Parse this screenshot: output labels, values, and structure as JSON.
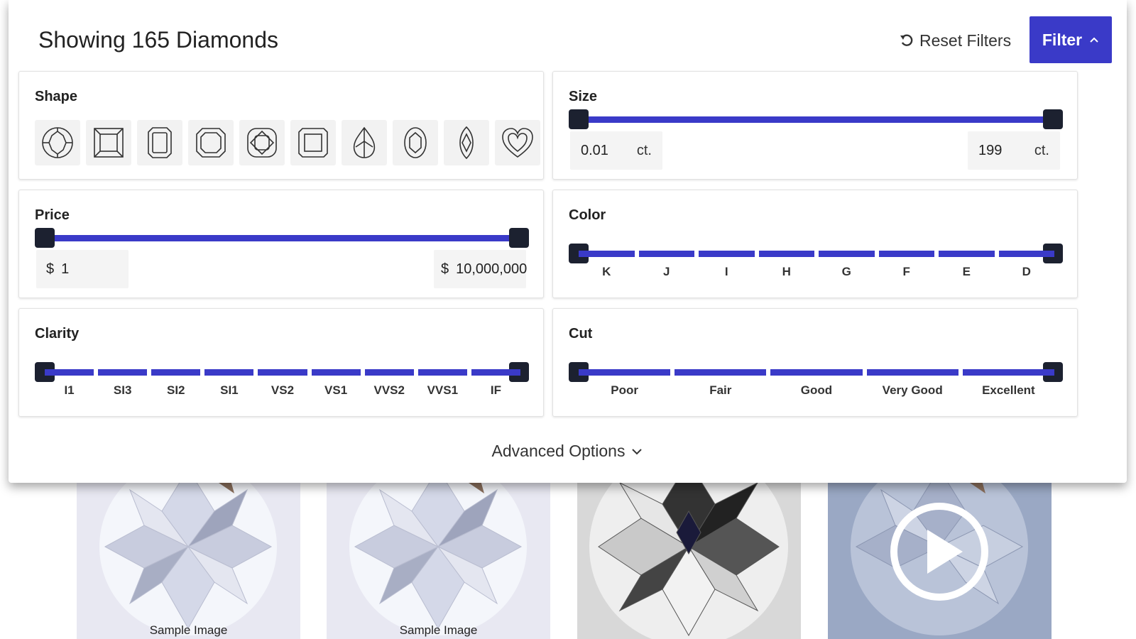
{
  "header": {
    "title": "Showing 165 Diamonds",
    "reset_label": "Reset Filters",
    "filter_label": "Filter"
  },
  "shape": {
    "title": "Shape",
    "icons": [
      "round-shape-icon",
      "princess-shape-icon",
      "emerald-shape-icon",
      "asscher-shape-icon",
      "cushion-shape-icon",
      "radiant-shape-icon",
      "pear-shape-icon",
      "oval-shape-icon",
      "marquise-shape-icon",
      "heart-shape-icon"
    ]
  },
  "size": {
    "title": "Size",
    "min": "0.01",
    "max": "199",
    "unit": "ct."
  },
  "price": {
    "title": "Price",
    "currency": "$",
    "min": "1",
    "max": "10,000,000"
  },
  "color": {
    "title": "Color",
    "grades": [
      "K",
      "J",
      "I",
      "H",
      "G",
      "F",
      "E",
      "D"
    ]
  },
  "clarity": {
    "title": "Clarity",
    "grades": [
      "I1",
      "SI3",
      "SI2",
      "SI1",
      "VS2",
      "VS1",
      "VVS2",
      "VVS1",
      "IF"
    ]
  },
  "cut": {
    "title": "Cut",
    "grades": [
      "Poor",
      "Fair",
      "Good",
      "Very Good",
      "Excellent"
    ]
  },
  "advanced_label": "Advanced Options",
  "cards": [
    {
      "label": "Sample Image",
      "bg": "#e8e8f2"
    },
    {
      "label": "Sample Image",
      "bg": "#e8e8f2"
    },
    {
      "label": "",
      "bg": "#d8d8d8"
    },
    {
      "label": "",
      "bg": "#9aa8c4"
    }
  ],
  "colors": {
    "accent": "#3a3ac8",
    "handle": "#1c2130"
  }
}
